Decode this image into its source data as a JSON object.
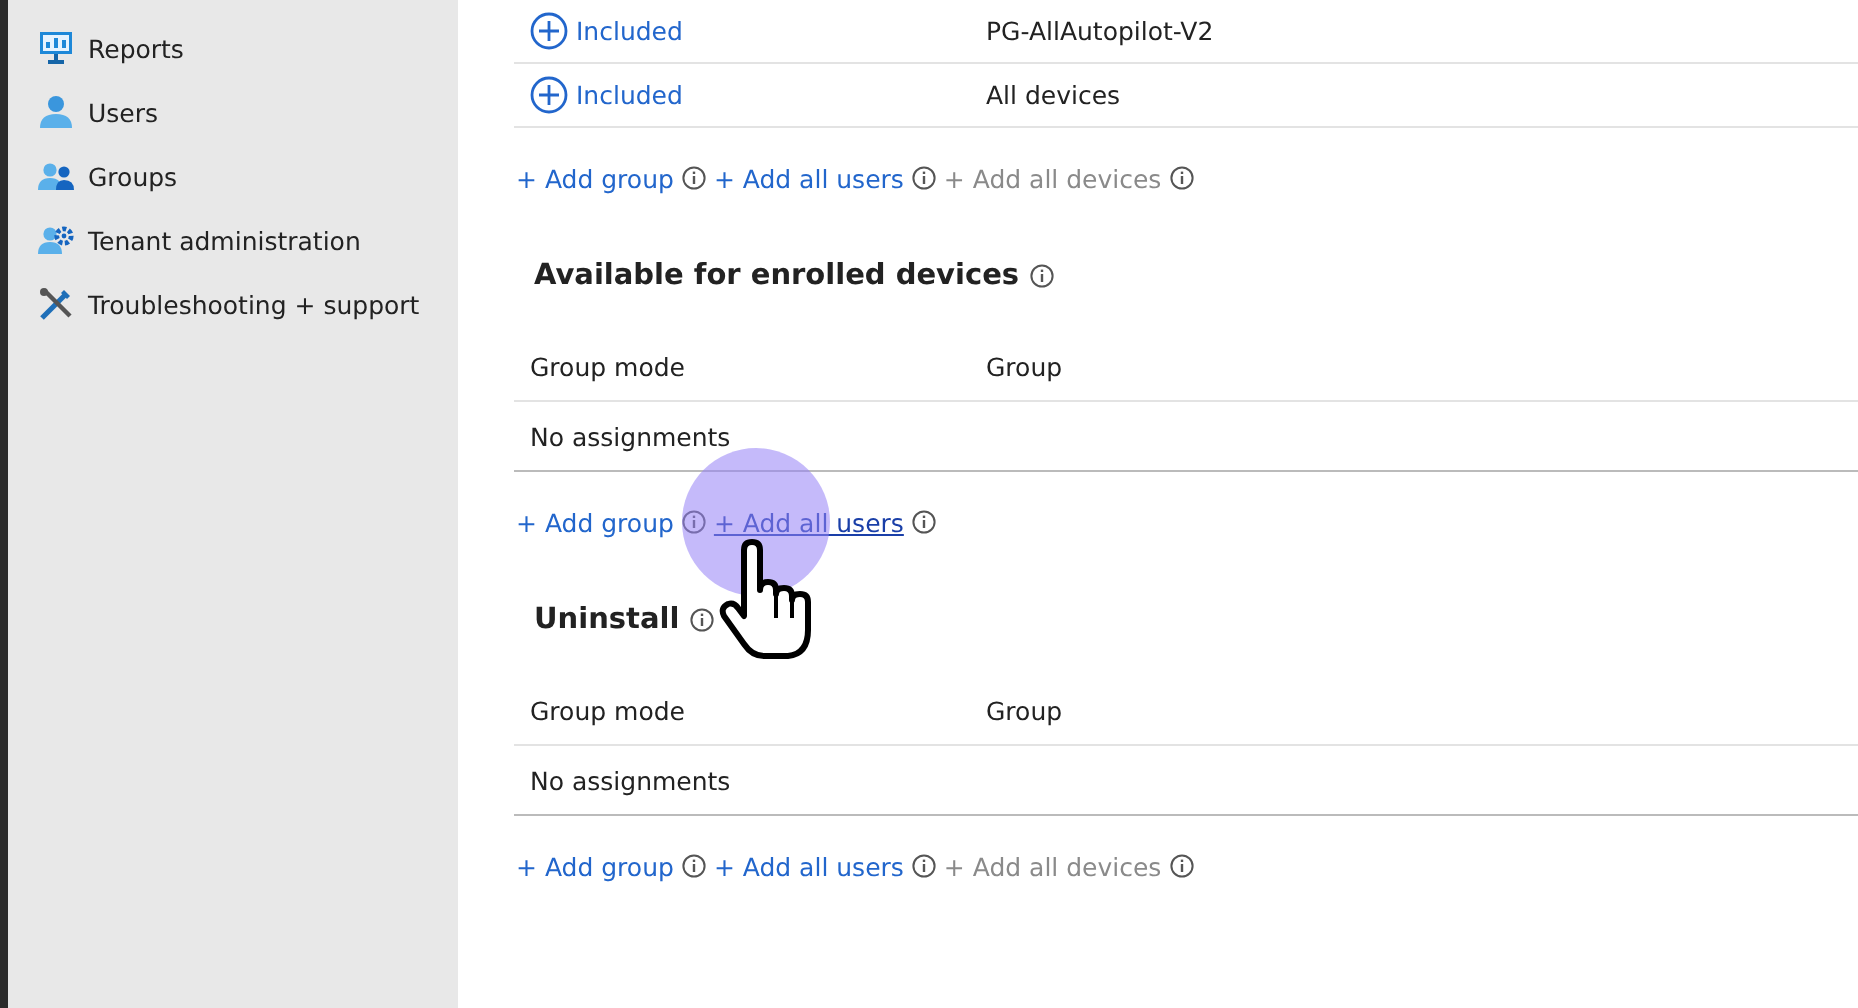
{
  "sidebar": {
    "items": [
      {
        "label": "Reports",
        "kind": "reports"
      },
      {
        "label": "Users",
        "kind": "user"
      },
      {
        "label": "Groups",
        "kind": "group"
      },
      {
        "label": "Tenant administration",
        "kind": "tenant"
      },
      {
        "label": "Troubleshooting + support",
        "kind": "tools"
      }
    ]
  },
  "included_rows": [
    {
      "mode": "Included",
      "group": "PG-AllAutopilot-V2"
    },
    {
      "mode": "Included",
      "group": "All devices"
    }
  ],
  "included_links": [
    {
      "label": "+ Add group",
      "disabled": false,
      "hovered": false
    },
    {
      "label": "+ Add all users",
      "disabled": false,
      "hovered": false
    },
    {
      "label": "+ Add all devices",
      "disabled": true,
      "hovered": false
    }
  ],
  "sections": [
    {
      "title": "Available for enrolled devices",
      "columns": [
        "Group mode",
        "Group"
      ],
      "empty_text": "No assignments",
      "links": [
        {
          "label": "+ Add group",
          "disabled": false,
          "hovered": false
        },
        {
          "label": "+ Add all users",
          "disabled": false,
          "hovered": true
        }
      ]
    },
    {
      "title": "Uninstall",
      "columns": [
        "Group mode",
        "Group"
      ],
      "empty_text": "No assignments",
      "links": [
        {
          "label": "+ Add group",
          "disabled": false,
          "hovered": false
        },
        {
          "label": "+ Add all users",
          "disabled": false,
          "hovered": false
        },
        {
          "label": "+ Add all devices",
          "disabled": true,
          "hovered": false
        }
      ]
    }
  ]
}
